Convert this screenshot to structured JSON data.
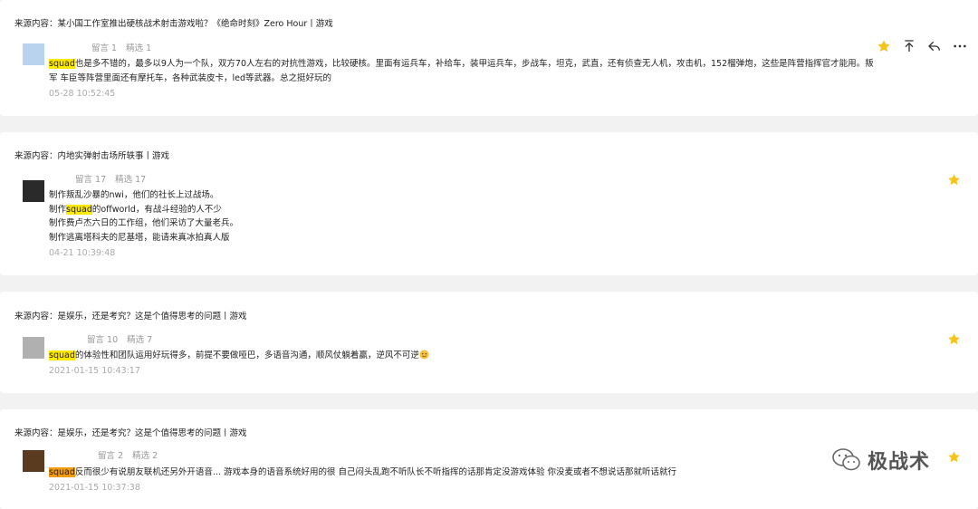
{
  "cards": [
    {
      "source": "来源内容：某小国工作室推出硬核战术射击游戏啦？《绝命时刻》Zero Hour丨游戏",
      "stats": {
        "comments": "留言 1",
        "selected": "精选 1"
      },
      "lines": [
        {
          "hl": "squad",
          "text": "也是多不错的，最多以9人为一个队，双方70人左右的对抗性游戏，比较硬核。里面有运兵车，补给车，装甲运兵车，步战车，坦克，武直，还有侦查无人机，攻击机，152榴弹炮，这些是阵营指挥官才能用。叛"
        },
        {
          "text": "军  车臣等阵营里面还有摩托车，各种武装皮卡，led等武器。总之挺好玩的"
        }
      ],
      "timestamp": "05-28 10:52:45"
    },
    {
      "source": "来源内容：内地实弹射击场所轶事丨游戏",
      "stats": {
        "comments": "留言 17",
        "selected": "精选 17"
      },
      "lines": [
        {
          "text": "制作叛乱沙暴的nwi，他们的社长上过战场。"
        },
        {
          "pre": "制作",
          "hl": "squad",
          "text": "的offworld，有战斗经验的人不少"
        },
        {
          "text": "制作费卢杰六日的工作组，他们采访了大量老兵。"
        },
        {
          "text": "制作逃离塔科夫的尼基塔，能请来真冰拍真人版"
        }
      ],
      "timestamp": "04-21 10:39:48"
    },
    {
      "source": "来源内容：是娱乐，还是考究？这是个值得思考的问题丨游戏",
      "stats": {
        "comments": "留言 10",
        "selected": "精选 7"
      },
      "lines": [
        {
          "hl": "squad",
          "text": "的体验性和团队运用好玩得多，前提不要做哑巴，多语音沟通，顺风仗躺着赢，逆风不可逆"
        }
      ],
      "timestamp": "2021-01-15 10:43:17"
    },
    {
      "source": "来源内容：是娱乐，还是考究？这是个值得思考的问题丨游戏",
      "stats": {
        "comments": "留言 2",
        "selected": "精选 2"
      },
      "lines": [
        {
          "hl": "squad",
          "text": "反而很少有说朋友联机还另外开语音... 游戏本身的语音系统好用的很 自己闷头乱跑不听队长不听指挥的话那肯定没游戏体验 你没麦或者不想说话那就听话就行"
        }
      ],
      "timestamp": "2021-01-15 10:37:38"
    }
  ],
  "icons": {
    "star": "star-icon",
    "pin": "pin-top-icon",
    "reply": "reply-icon",
    "more": "more-icon"
  },
  "colors": {
    "star": "#f7c21a",
    "highlight": "#ffe900",
    "highlight_alt": "#f39c12"
  },
  "watermark": {
    "text": "极战术"
  }
}
